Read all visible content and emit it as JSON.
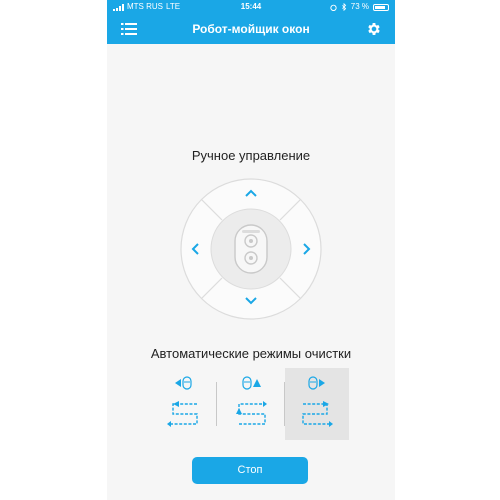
{
  "status_bar": {
    "carrier": "MTS RUS",
    "network": "LTE",
    "time": "15:44",
    "battery": "73 %"
  },
  "header": {
    "title": "Робот-мойщик окон"
  },
  "manual_control": {
    "title": "Ручное управление"
  },
  "auto_modes": {
    "title": "Автоматические режимы очистки",
    "selected_index": 2
  },
  "actions": {
    "stop_label": "Стоп"
  },
  "colors": {
    "accent": "#1aa7e6",
    "selected_bg": "#e4e4e4",
    "dpad_ring": "#dddddd",
    "dpad_center": "#e9e9e9"
  }
}
